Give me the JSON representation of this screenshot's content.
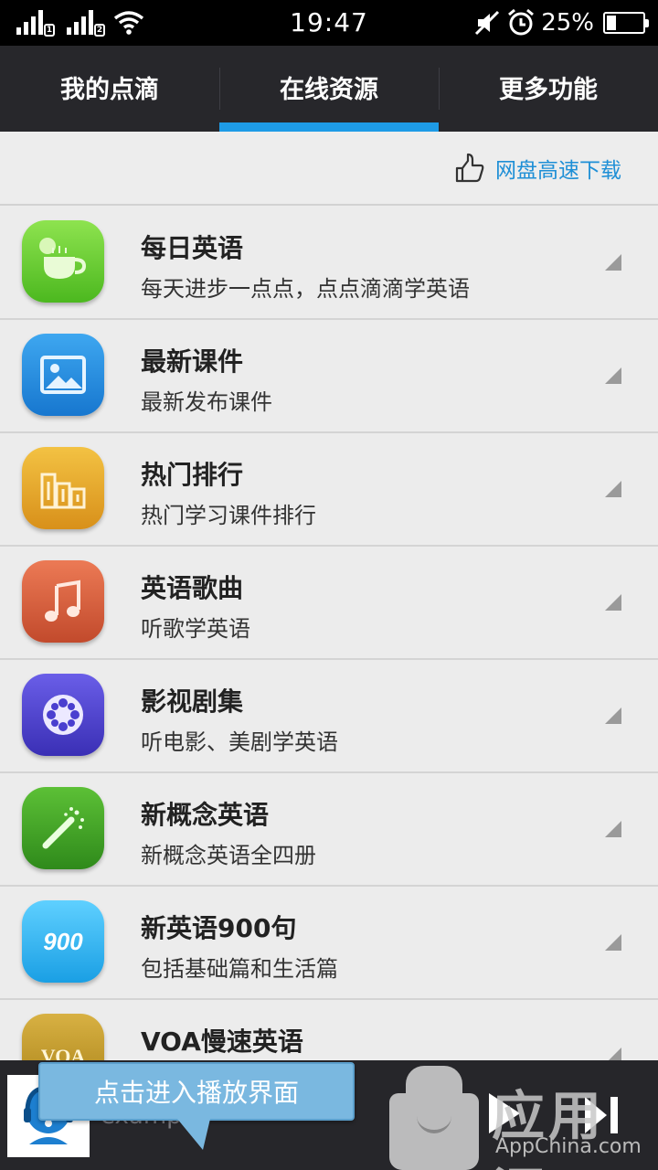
{
  "status_bar": {
    "time": "19:47",
    "battery_percent_text": "25%",
    "battery_level": 0.25,
    "sim1_label": "1",
    "sim2_label": "2"
  },
  "tabs": [
    {
      "label": "我的点滴",
      "active": false
    },
    {
      "label": "在线资源",
      "active": true
    },
    {
      "label": "更多功能",
      "active": false
    }
  ],
  "download_link": {
    "label": "网盘高速下载",
    "icon": "thumbs-up-icon"
  },
  "list": [
    {
      "title": "每日英语",
      "subtitle": "每天进步一点点，点点滴滴学英语",
      "icon": "coffee-cup-icon",
      "color": "#5fc12e"
    },
    {
      "title": "最新课件",
      "subtitle": "最新发布课件",
      "icon": "image-icon",
      "color": "#1e88d9"
    },
    {
      "title": "热门排行",
      "subtitle": "热门学习课件排行",
      "icon": "ranking-bars-icon",
      "color": "#e0a21c"
    },
    {
      "title": "英语歌曲",
      "subtitle": "听歌学英语",
      "icon": "music-note-icon",
      "color": "#d45a3a"
    },
    {
      "title": "影视剧集",
      "subtitle": "听电影、美剧学英语",
      "icon": "film-reel-icon",
      "color": "#4a3fcf"
    },
    {
      "title": "新概念英语",
      "subtitle": "新概念英语全四册",
      "icon": "magic-wand-icon",
      "color": "#3d9d24"
    },
    {
      "title": "新英语900句",
      "subtitle": "包括基础篇和生活篇",
      "icon": "900-icon",
      "color": "#27b1ee"
    },
    {
      "title": "VOA慢速英语",
      "subtitle": "",
      "icon": "voa-icon",
      "color": "#c29a2a"
    }
  ],
  "player": {
    "song": "example",
    "tooltip": "点击进入播放界面"
  },
  "watermark": {
    "cn": "应用汇",
    "en": "AppChina.com"
  }
}
